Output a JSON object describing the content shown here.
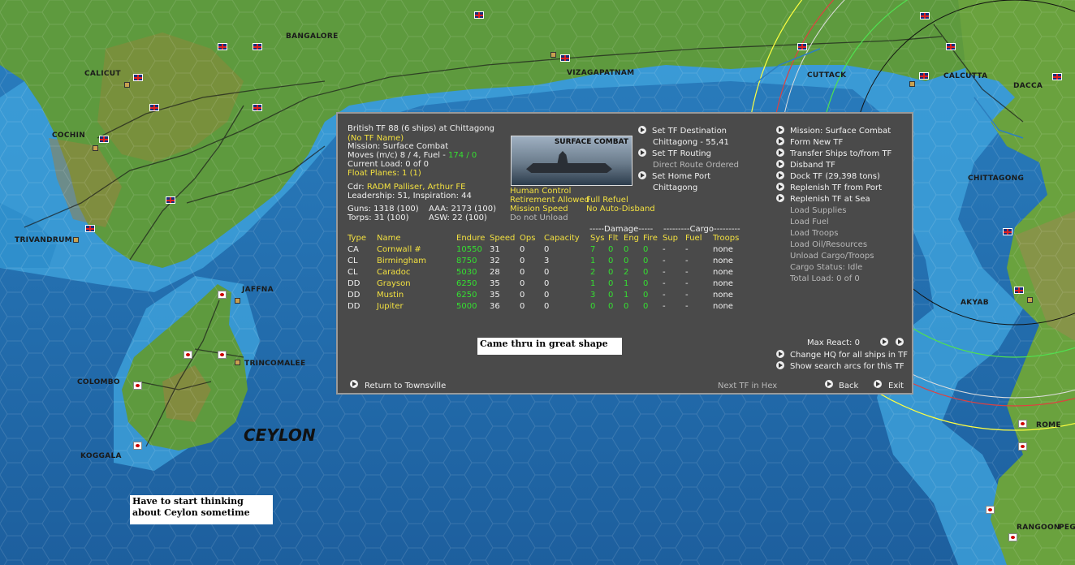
{
  "map": {
    "cities": [
      "BANGALORE",
      "CALICUT",
      "COCHIN",
      "TRIVANDRUM",
      "VIZAGAPATNAM",
      "CUTTACK",
      "CALCUTTA",
      "DACCA",
      "CHITTAGONG",
      "AKYAB",
      "JAFFNA",
      "TRINCOMALEE",
      "COLOMBO",
      "KOGGALA",
      "ROME",
      "RANGOON",
      "PEG"
    ],
    "region_label": "CEYLON",
    "notes": [
      "Have to start thinking about Ceylon sometime",
      "Came thru in great shape"
    ]
  },
  "panel": {
    "header": {
      "title": "British TF 88 (6 ships) at Chittagong",
      "tf_name": "(No TF Name)",
      "mission": "Mission: Surface Combat",
      "moves": "Moves (m/c)  8 / 4, Fuel - ",
      "fuel": "174 / 0",
      "load": "Current Load: 0 of 0",
      "float_planes": "Float Planes: 1 (1)",
      "cdr_label": "Cdr:",
      "cdr_name": "RADM  Palliser, Arthur FE",
      "leadership": "Leadership: 51, Inspiration: 44",
      "guns": "Guns: 1318 (100)",
      "aaa": "AAA: 2173 (100)",
      "torps": "Torps: 31 (100)",
      "asw": "ASW: 22 (100)"
    },
    "image_caption": "SURFACE COMBAT",
    "settings": {
      "human_control": "Human Control",
      "retirement": "Retirement Allowed",
      "full_refuel": "Full Refuel",
      "mission_speed": "Mission Speed",
      "no_auto_disband": "No Auto-Disband",
      "do_not_unload": "Do not Unload"
    },
    "route": {
      "set_destination": "Set TF Destination",
      "destination": "Chittagong - 55,41",
      "set_routing": "Set TF Routing",
      "direct_route": "Direct Route Ordered",
      "set_home": "Set Home Port",
      "home": "Chittagong"
    },
    "actions": {
      "mission": "Mission: Surface Combat",
      "form_new": "Form New TF",
      "transfer": "Transfer Ships to/from TF",
      "disband": "Disband TF",
      "dock": "Dock TF (29,398 tons)",
      "replenish_port": "Replenish TF from Port",
      "replenish_sea": "Replenish TF at Sea",
      "load_supplies": "Load Supplies",
      "load_fuel": "Load Fuel",
      "load_troops": "Load Troops",
      "load_oil": "Load Oil/Resources",
      "unload": "Unload Cargo/Troops",
      "cargo_status": "Cargo Status: Idle",
      "total_load": "Total Load: 0 of 0"
    },
    "table": {
      "group_damage": "-----Damage-----",
      "group_cargo": "---------Cargo---------",
      "headers": [
        "Type",
        "Name",
        "Endure",
        "Speed",
        "Ops",
        "Capacity",
        "Sys",
        "Flt",
        "Eng",
        "Fire",
        "Sup",
        "Fuel",
        "Troops"
      ],
      "rows": [
        [
          "CA",
          "Cornwall #",
          "10550",
          "31",
          "0",
          "0",
          "7",
          "0",
          "0",
          "0",
          "-",
          "-",
          "none"
        ],
        [
          "CL",
          "Birmingham",
          "8750",
          "32",
          "0",
          "3",
          "1",
          "0",
          "0",
          "0",
          "-",
          "-",
          "none"
        ],
        [
          "CL",
          "Caradoc",
          "5030",
          "28",
          "0",
          "0",
          "2",
          "0",
          "2",
          "0",
          "-",
          "-",
          "none"
        ],
        [
          "DD",
          "Grayson",
          "6250",
          "35",
          "0",
          "0",
          "1",
          "0",
          "1",
          "0",
          "-",
          "-",
          "none"
        ],
        [
          "DD",
          "Mustin",
          "6250",
          "35",
          "0",
          "0",
          "3",
          "0",
          "1",
          "0",
          "-",
          "-",
          "none"
        ],
        [
          "DD",
          "Jupiter",
          "5000",
          "36",
          "0",
          "0",
          "0",
          "0",
          "0",
          "0",
          "-",
          "-",
          "none"
        ]
      ]
    },
    "bottom": {
      "max_react": "Max React:  0",
      "change_hq": "Change HQ for all ships in TF",
      "search_arcs": "Show search arcs for this TF",
      "return": "Return to Townsville",
      "next_tf": "Next TF in Hex",
      "back": "Back",
      "exit": "Exit"
    }
  }
}
